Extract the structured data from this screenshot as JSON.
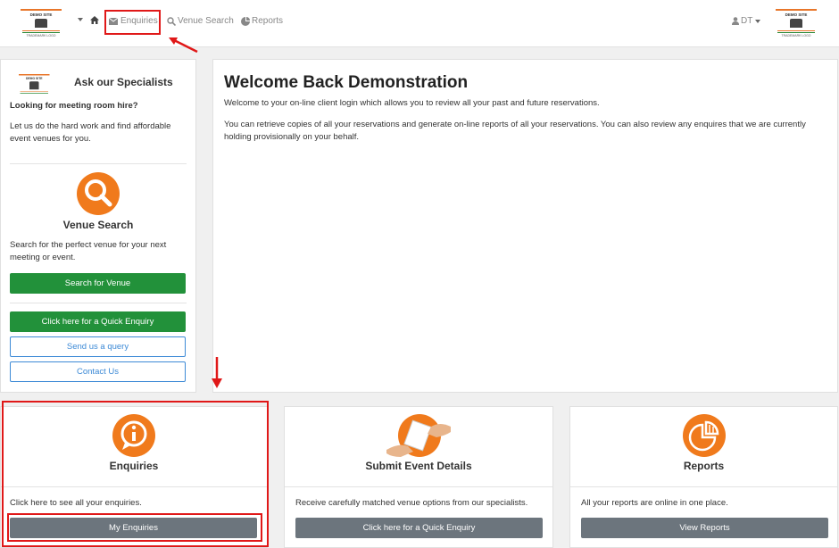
{
  "header": {
    "logo_title": "DEMO SITE",
    "logo_sub": "TRADEMARK LOGO",
    "nav": {
      "enquiries": "Enquiries",
      "venue_search": "Venue Search",
      "reports": "Reports"
    },
    "user": "DT"
  },
  "sidebar": {
    "title": "Ask our Specialists",
    "heading": "Looking for meeting room hire?",
    "intro": "Let us do the hard work and find affordable event venues for you.",
    "venue_title": "Venue Search",
    "venue_text": "Search for the perfect venue for your next meeting or event.",
    "search_button": "Search for Venue",
    "quick_button": "Click here for a Quick Enquiry",
    "query_button": "Send us a query",
    "contact_button": "Contact Us"
  },
  "welcome": {
    "title": "Welcome Back Demonstration",
    "p1": "Welcome to your on-line client login which allows you to review all your past and future reservations.",
    "p2": "You can retrieve copies of all your reservations and generate on-line reports of all your reservations. You can also review any enquires that we are currently holding provisionally on your behalf."
  },
  "cards": [
    {
      "title": "Enquiries",
      "text": "Click here to see all your enquiries.",
      "button": "My Enquiries"
    },
    {
      "title": "Submit Event Details",
      "text": "Receive carefully matched venue options from our specialists.",
      "button": "Click here for a Quick Enquiry"
    },
    {
      "title": "Reports",
      "text": "All your reports are online in one place.",
      "button": "View Reports"
    }
  ],
  "colors": {
    "accent_orange": "#f07a1c",
    "green": "#22913a",
    "annotation_red": "#e01818"
  }
}
